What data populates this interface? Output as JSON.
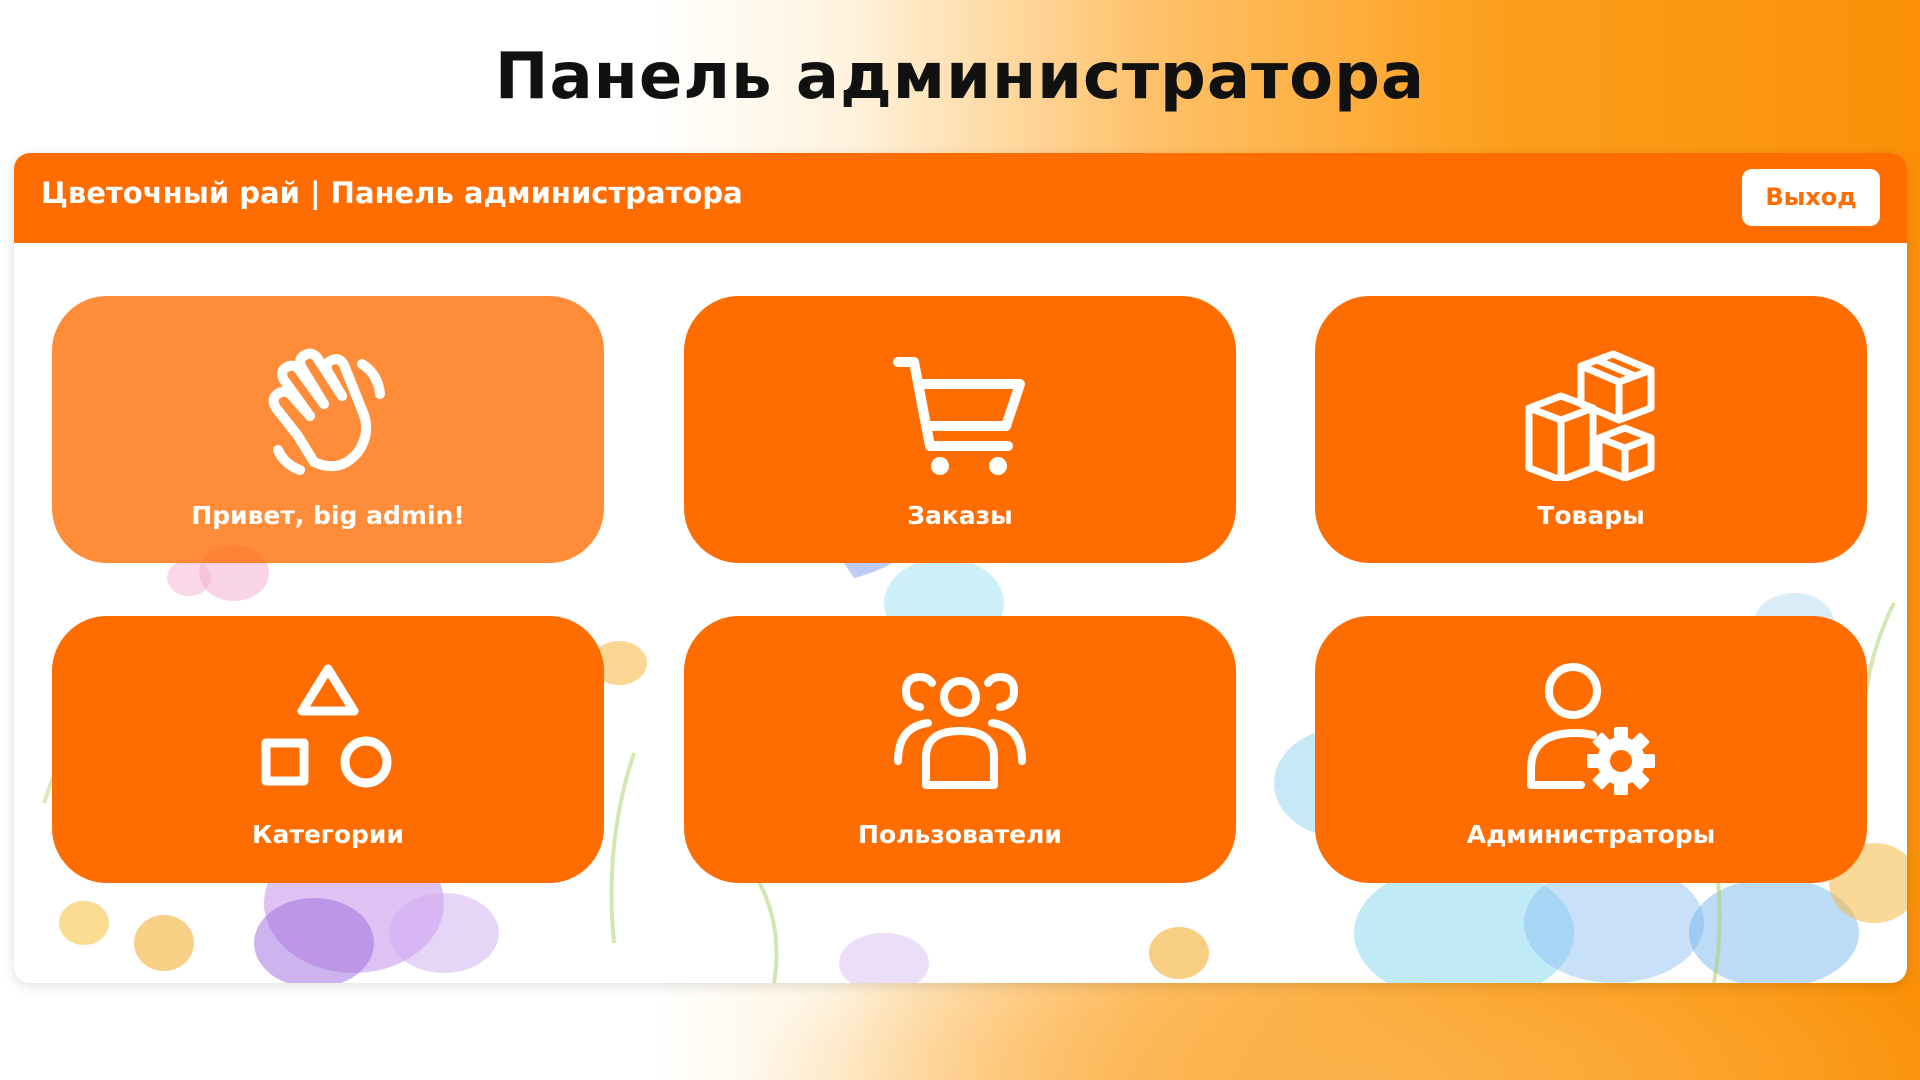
{
  "slide": {
    "title": "Панель администратора"
  },
  "header": {
    "brand": "Цветочный рай | Панель администратора",
    "logout_label": "Выход"
  },
  "colors": {
    "accent": "#ff6c00",
    "card_text": "#ffffff",
    "page_title": "#111111"
  },
  "cards": [
    {
      "label": "Привет, big admin!",
      "icon": "waving-hand-icon"
    },
    {
      "label": "Заказы",
      "icon": "shopping-cart-icon"
    },
    {
      "label": "Товары",
      "icon": "boxes-icon"
    },
    {
      "label": "Категории",
      "icon": "shapes-icon"
    },
    {
      "label": "Пользователи",
      "icon": "users-group-icon"
    },
    {
      "label": "Администраторы",
      "icon": "user-gear-icon"
    }
  ]
}
